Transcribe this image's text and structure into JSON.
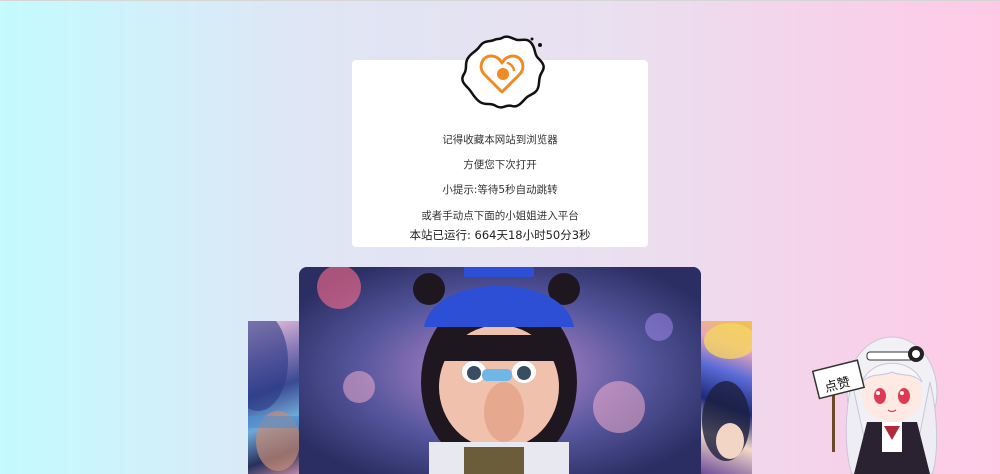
{
  "notice": {
    "line1": "记得收藏本网站到浏览器",
    "line2": "方便您下次打开",
    "line3": "小提示:等待5秒自动跳转",
    "line4": "或者手动点下面的小姐姐进入平台",
    "runtime": "本站已运行: 664天18小时50分3秒"
  },
  "logo": {
    "icon": "heart-logo-icon",
    "accent_color": "#f08a24"
  },
  "carousel": {
    "slides": [
      "slide-left",
      "slide-main",
      "slide-right"
    ]
  },
  "mascot": {
    "sign_text": "点赞",
    "icon": "anime-girl-mascot"
  },
  "colors": {
    "bg_left": "#c3fbff",
    "bg_right": "#ffc9e6",
    "card_bg": "#ffffff"
  }
}
